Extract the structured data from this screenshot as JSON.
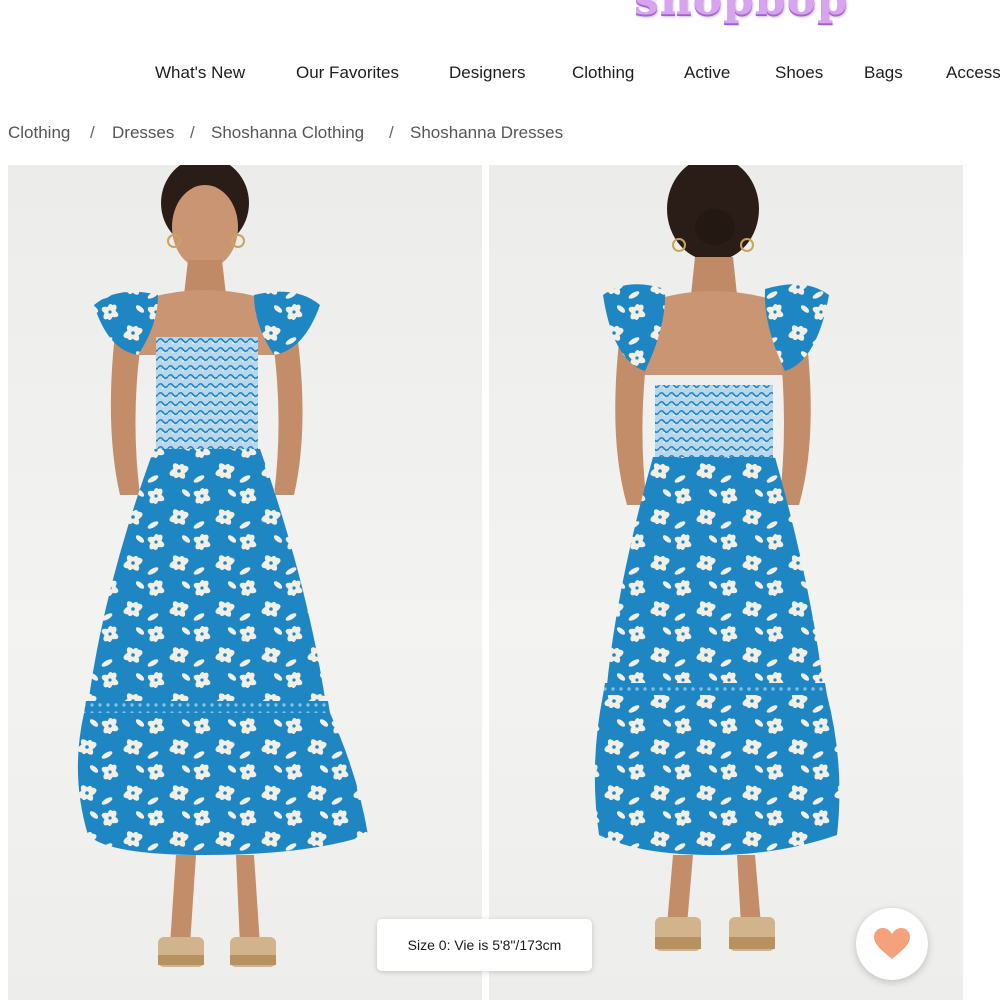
{
  "brand": {
    "logo_text": "shopbop",
    "logo_color": "#d7a5ee"
  },
  "nav": {
    "items": [
      {
        "label": "What's New"
      },
      {
        "label": "Our Favorites"
      },
      {
        "label": "Designers"
      },
      {
        "label": "Clothing"
      },
      {
        "label": "Active"
      },
      {
        "label": "Shoes"
      },
      {
        "label": "Bags"
      },
      {
        "label": "Access"
      }
    ]
  },
  "breadcrumb": {
    "items": [
      {
        "label": "Clothing"
      },
      {
        "label": "Dresses"
      },
      {
        "label": "Shoshanna Clothing"
      },
      {
        "label": "Shoshanna Dresses"
      }
    ],
    "separator": "/"
  },
  "gallery": {
    "images": [
      {
        "icon": "product-photo-front"
      },
      {
        "icon": "product-photo-back"
      }
    ],
    "size_caption": "Size 0: Vie is 5'8\"/173cm"
  },
  "favorite": {
    "icon": "heart-icon",
    "color": "#f5a27c"
  },
  "colors": {
    "dress_blue": "#1f86c4",
    "flower_white": "#f2efe6",
    "background": "#ffffff"
  }
}
